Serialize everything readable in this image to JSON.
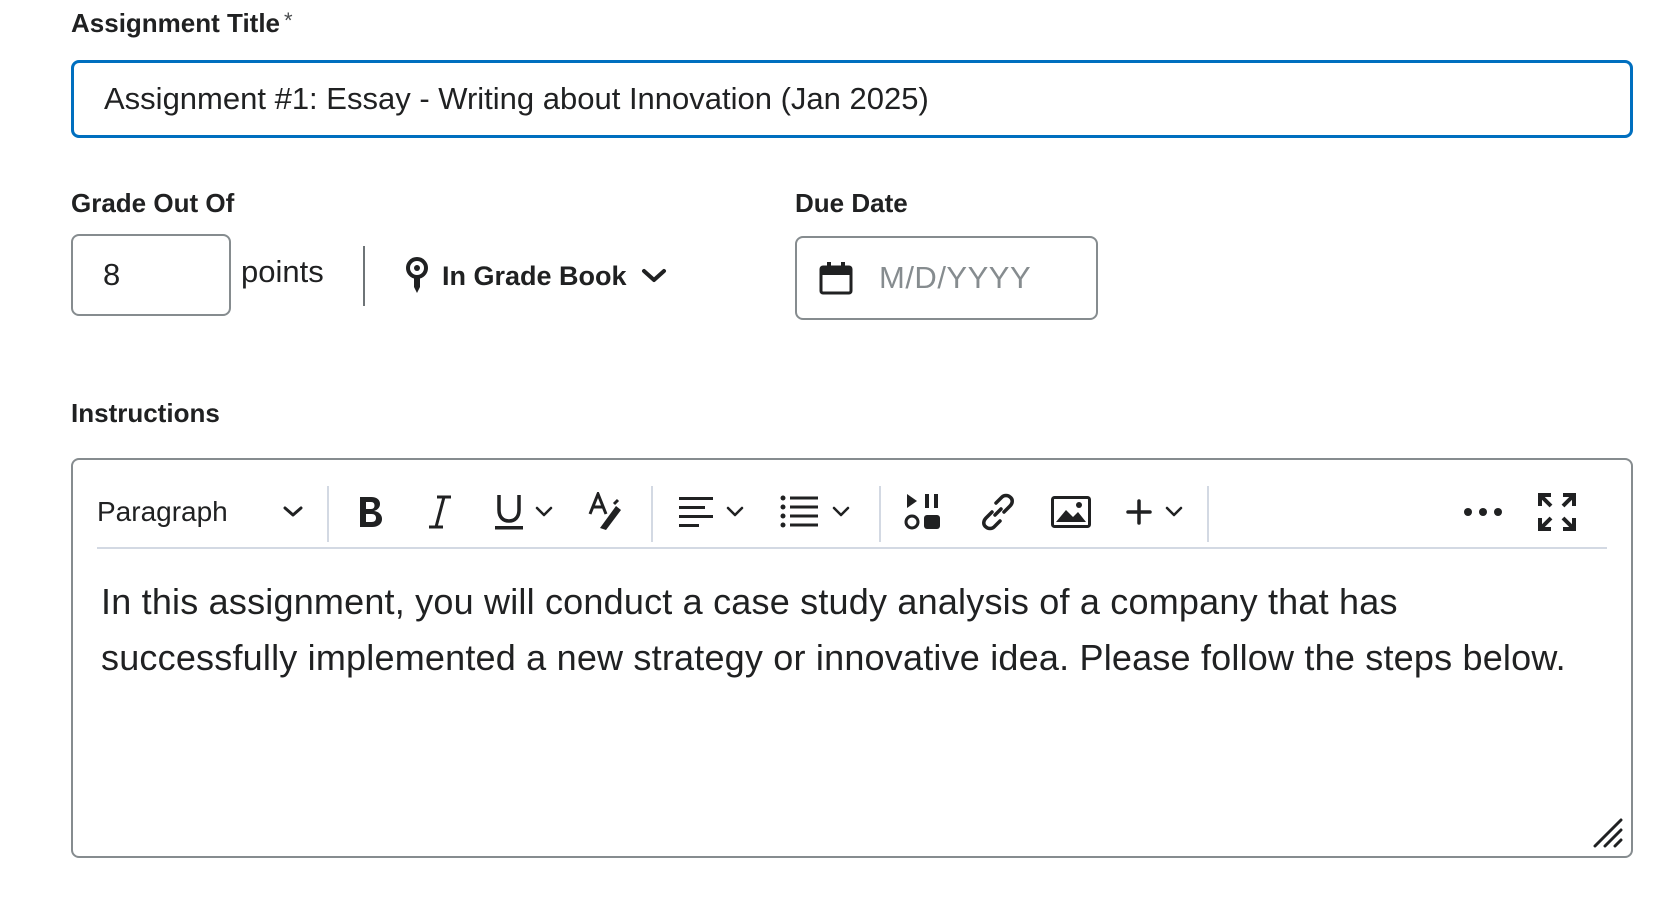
{
  "assignment_title": {
    "label": "Assignment Title",
    "required_marker": "*",
    "value": "Assignment #1: Essay - Writing about Innovation (Jan 2025)"
  },
  "grade": {
    "label": "Grade Out Of",
    "value": "8",
    "unit": "points",
    "gradebook_label": "In Grade Book"
  },
  "due_date": {
    "label": "Due Date",
    "placeholder": "M/D/YYYY"
  },
  "instructions": {
    "label": "Instructions",
    "toolbar": {
      "format_label": "Paragraph"
    },
    "content": "In this assignment, you will conduct a case study analysis of a company that has successfully implemented a new strategy or innovative idea. Please follow the steps below."
  },
  "colors": {
    "focus_border": "#006fbf",
    "text": "#202122",
    "border": "#868c8f",
    "placeholder": "#868c8f"
  }
}
